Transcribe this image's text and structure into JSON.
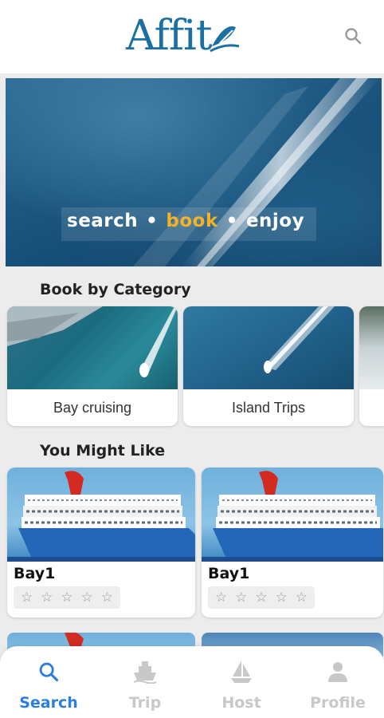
{
  "header": {
    "logo_text": "Affit",
    "logo_alt": "Affito"
  },
  "hero": {
    "tagline_search": "search",
    "tagline_book": "book",
    "tagline_enjoy": "enjoy",
    "separator": "•"
  },
  "categories": {
    "title": "Book by Category",
    "items": [
      {
        "label": "Bay cruising"
      },
      {
        "label": "Island Trips"
      }
    ]
  },
  "you_might_like": {
    "title": "You Might Like",
    "items": [
      {
        "name": "Bay1",
        "rating": 0,
        "max_rating": 5
      },
      {
        "name": "Bay1",
        "rating": 0,
        "max_rating": 5
      }
    ]
  },
  "tabbar": {
    "tabs": [
      {
        "label": "Search",
        "icon": "search-icon",
        "active": true
      },
      {
        "label": "Trip",
        "icon": "ship-icon",
        "active": false
      },
      {
        "label": "Host",
        "icon": "sailboat-icon",
        "active": false
      },
      {
        "label": "Profile",
        "icon": "person-icon",
        "active": false
      }
    ]
  },
  "colors": {
    "brand": "#1a6fa3",
    "accent_book": "#f5b128",
    "active_tab": "#2a7de1",
    "inactive_tab": "#c8c8c8"
  }
}
